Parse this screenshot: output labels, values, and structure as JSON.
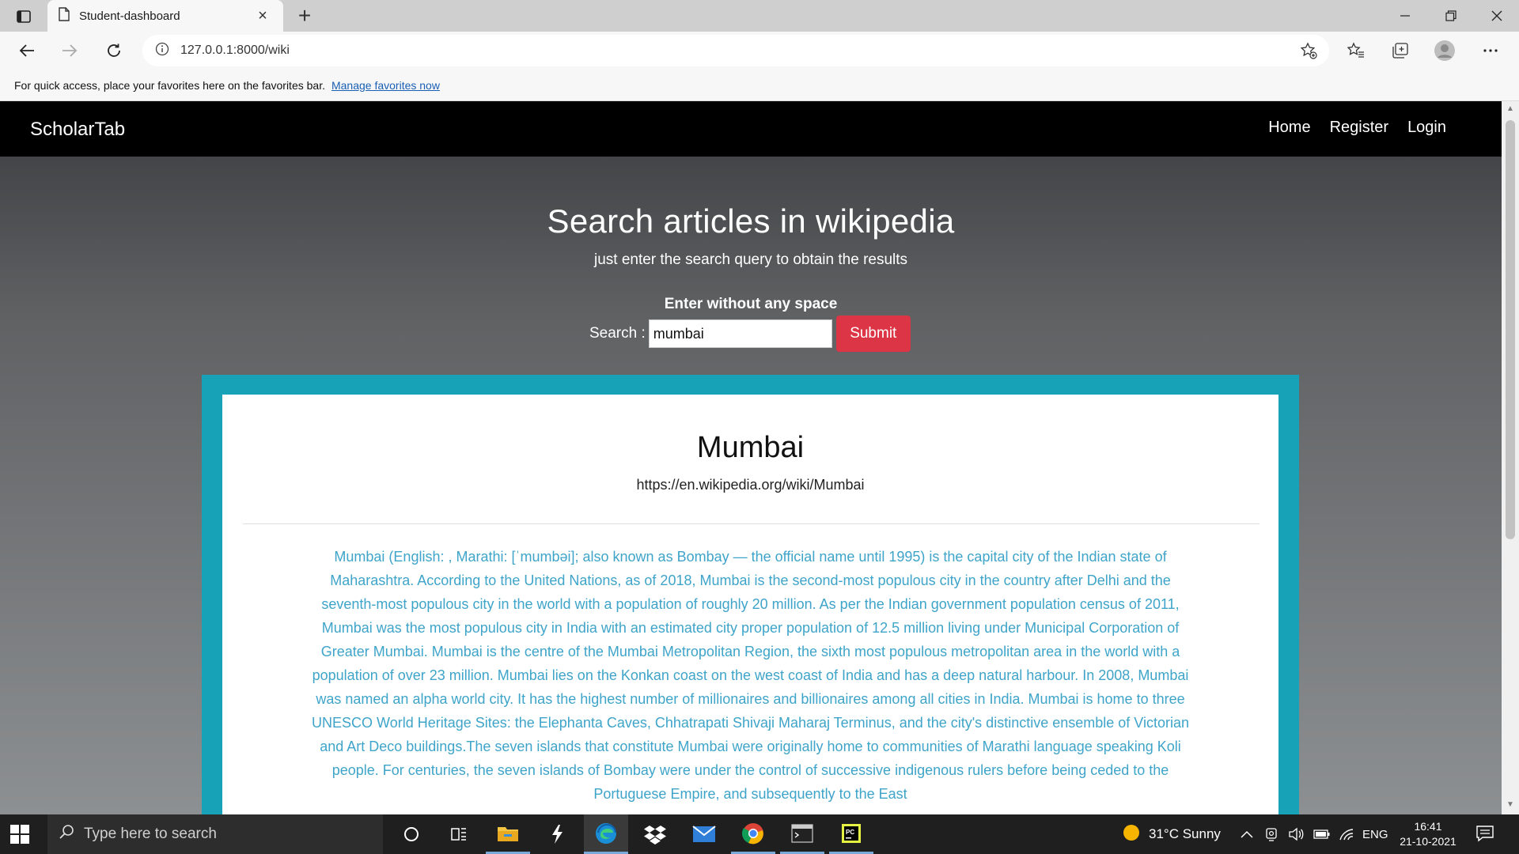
{
  "browser": {
    "tab_title": "Student-dashboard",
    "tab_close": "×",
    "new_tab": "+",
    "url": "127.0.0.1:8000/wiki",
    "favorites_message": "For quick access, place your favorites here on the favorites bar.",
    "favorites_link": "Manage favorites now",
    "icons": [
      "tab-actions-icon",
      "page-icon",
      "back-icon",
      "forward-icon",
      "refresh-icon",
      "info-icon",
      "add-favorite-icon",
      "favorites-icon",
      "collections-icon",
      "profile-icon",
      "more-icon",
      "minimize-icon",
      "restore-icon",
      "close-window-icon"
    ]
  },
  "site": {
    "brand": "ScholarTab",
    "nav": {
      "home": "Home",
      "register": "Register",
      "login": "Login"
    },
    "hero_title": "Search articles in wikipedia",
    "hero_subtitle": "just enter the search query to obtain the results",
    "hint": "Enter without any space",
    "search_label": "Search :",
    "search_value": "mumbai",
    "submit_label": "Submit",
    "accent_color": "#17a2b8",
    "button_color": "#dc3545",
    "result": {
      "title": "Mumbai",
      "url": "https://en.wikipedia.org/wiki/Mumbai",
      "summary": "Mumbai (English: , Marathi: [ˈmumbəi]; also known as Bombay — the official name until 1995) is the capital city of the Indian state of Maharashtra. According to the United Nations, as of 2018, Mumbai is the second-most populous city in the country after Delhi and the seventh-most populous city in the world with a population of roughly 20 million. As per the Indian government population census of 2011, Mumbai was the most populous city in India with an estimated city proper population of 12.5 million living under Municipal Corporation of Greater Mumbai. Mumbai is the centre of the Mumbai Metropolitan Region, the sixth most populous metropolitan area in the world with a population of over 23 million. Mumbai lies on the Konkan coast on the west coast of India and has a deep natural harbour. In 2008, Mumbai was named an alpha world city. It has the highest number of millionaires and billionaires among all cities in India. Mumbai is home to three UNESCO World Heritage Sites: the Elephanta Caves, Chhatrapati Shivaji Maharaj Terminus, and the city's distinctive ensemble of Victorian and Art Deco buildings.The seven islands that constitute Mumbai were originally home to communities of Marathi language speaking Koli people. For centuries, the seven islands of Bombay were under the control of successive indigenous rulers before being ceded to the Portuguese Empire, and subsequently to the East"
    }
  },
  "taskbar": {
    "search_placeholder": "Type here to search",
    "weather": "31°C  Sunny",
    "language": "ENG",
    "time": "16:41",
    "date": "21-10-2021",
    "apps": [
      "task-view-icon",
      "cortana-icon",
      "file-explorer-icon",
      "app-icon",
      "edge-icon",
      "dropbox-icon",
      "mail-icon",
      "chrome-icon",
      "terminal-icon",
      "pycharm-icon"
    ]
  }
}
